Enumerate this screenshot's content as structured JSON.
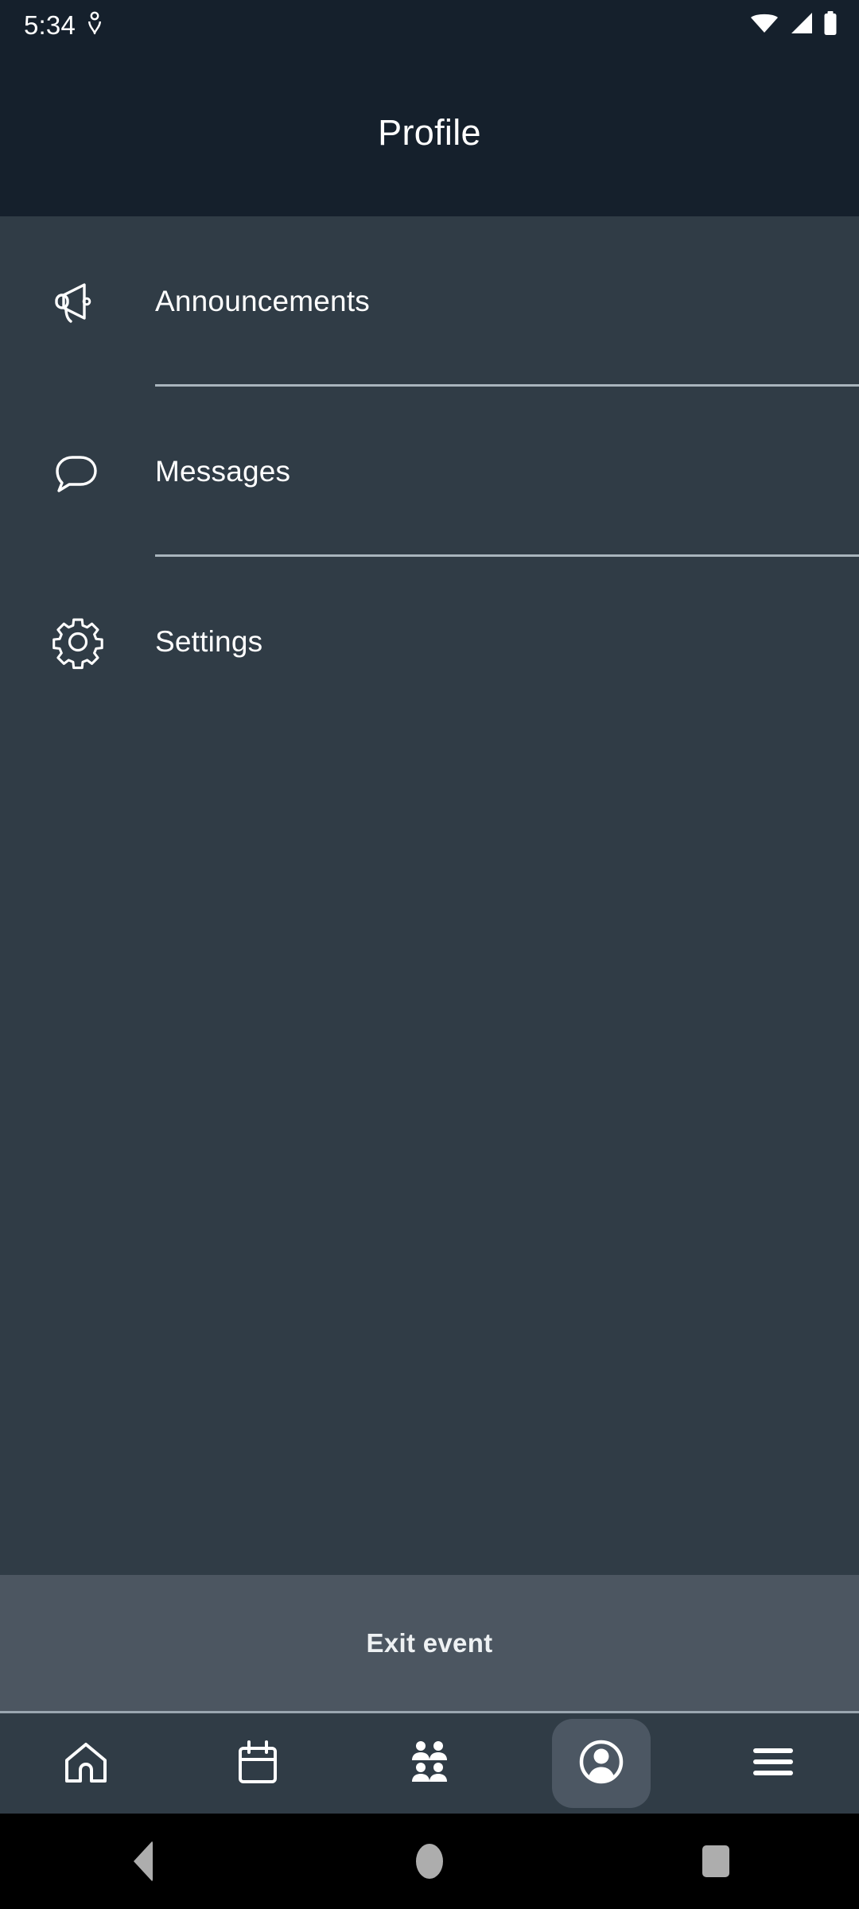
{
  "status_bar": {
    "time": "5:34",
    "icons": [
      "location-icon",
      "wifi-icon",
      "cellular-signal-icon",
      "battery-icon"
    ]
  },
  "header": {
    "title": "Profile"
  },
  "menu": {
    "items": [
      {
        "label": "Announcements",
        "icon": "megaphone-icon",
        "divider": true
      },
      {
        "label": "Messages",
        "icon": "chat-bubble-icon",
        "divider": true
      },
      {
        "label": "Settings",
        "icon": "gear-icon",
        "divider": false
      }
    ]
  },
  "exit": {
    "label": "Exit event"
  },
  "bottom_nav": {
    "items": [
      {
        "name": "home",
        "icon": "home-icon",
        "active": false
      },
      {
        "name": "schedule",
        "icon": "calendar-icon",
        "active": false
      },
      {
        "name": "attendees",
        "icon": "people-group-icon",
        "active": false
      },
      {
        "name": "profile",
        "icon": "person-circle-icon",
        "active": true
      },
      {
        "name": "more",
        "icon": "hamburger-menu-icon",
        "active": false
      }
    ]
  },
  "android_nav": {
    "buttons": [
      {
        "name": "back",
        "icon": "back-triangle-icon"
      },
      {
        "name": "home",
        "icon": "home-pill-icon"
      },
      {
        "name": "recents",
        "icon": "recents-square-icon"
      }
    ]
  },
  "colors": {
    "header_bg": "#15202c",
    "content_bg": "#303c46",
    "exit_bg": "#4c5661",
    "divider": "#a9b5bd",
    "active_tab_bg": "#4c5763",
    "text": "#ffffff"
  }
}
